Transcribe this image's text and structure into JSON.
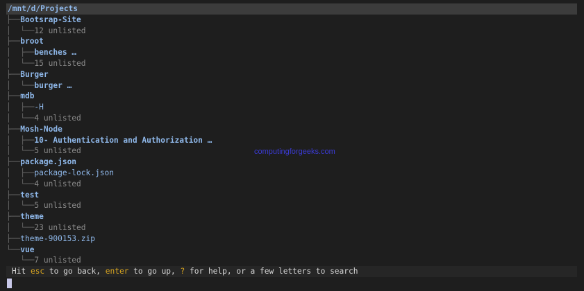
{
  "header": {
    "path": "/mnt/d/Projects"
  },
  "tree": [
    {
      "branch": "├──",
      "name": "Bootsrap-Site",
      "kind": "dir"
    },
    {
      "branch": "│  └──",
      "name": "12 unlisted",
      "kind": "unlisted"
    },
    {
      "branch": "├──",
      "name": "broot",
      "kind": "dir"
    },
    {
      "branch": "│  ├──",
      "name": "benches …",
      "kind": "dir"
    },
    {
      "branch": "│  └──",
      "name": "15 unlisted",
      "kind": "unlisted"
    },
    {
      "branch": "├──",
      "name": "Burger",
      "kind": "dir"
    },
    {
      "branch": "│  └──",
      "name": "burger …",
      "kind": "dir"
    },
    {
      "branch": "├──",
      "name": "mdb",
      "kind": "dir"
    },
    {
      "branch": "│  ├──",
      "name": "-H",
      "kind": "file"
    },
    {
      "branch": "│  └──",
      "name": "4 unlisted",
      "kind": "unlisted"
    },
    {
      "branch": "├──",
      "name": "Mosh-Node",
      "kind": "dir"
    },
    {
      "branch": "│  ├──",
      "name": "10- Authentication and Authorization …",
      "kind": "dir"
    },
    {
      "branch": "│  └──",
      "name": "5 unlisted",
      "kind": "unlisted"
    },
    {
      "branch": "├──",
      "name": "package.json",
      "kind": "dir"
    },
    {
      "branch": "│  ├──",
      "name": "package-lock.json",
      "kind": "file"
    },
    {
      "branch": "│  └──",
      "name": "4 unlisted",
      "kind": "unlisted"
    },
    {
      "branch": "├──",
      "name": "test",
      "kind": "dir"
    },
    {
      "branch": "│  └──",
      "name": "5 unlisted",
      "kind": "unlisted"
    },
    {
      "branch": "├──",
      "name": "theme",
      "kind": "dir"
    },
    {
      "branch": "│  └──",
      "name": "23 unlisted",
      "kind": "unlisted"
    },
    {
      "branch": "├──",
      "name": "theme-900153.zip",
      "kind": "file"
    },
    {
      "branch": "└──",
      "name": "vue",
      "kind": "dir"
    },
    {
      "branch": "   └──",
      "name": "7 unlisted",
      "kind": "unlisted"
    }
  ],
  "status": {
    "p1": "Hit ",
    "k1": "esc",
    "p2": " to go back, ",
    "k2": "enter",
    "p3": " to go up, ",
    "k3": "?",
    "p4": " for help, or a few letters to search"
  },
  "watermark": "computingforgeeks.com"
}
